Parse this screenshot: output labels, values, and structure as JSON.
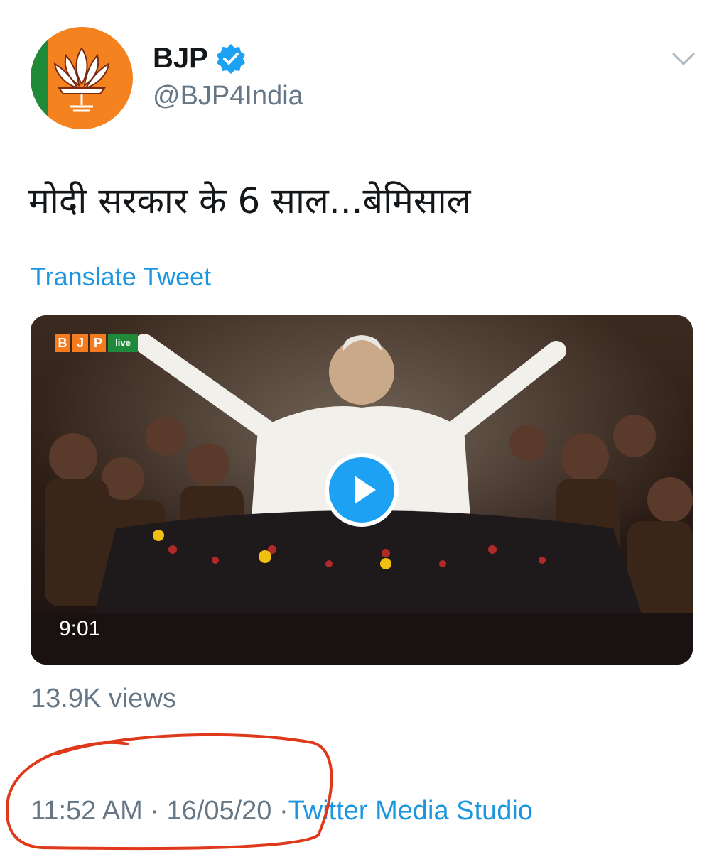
{
  "account": {
    "display_name": "BJP",
    "handle": "@BJP4India",
    "verified": true,
    "avatar_icon": "lotus-logo-icon"
  },
  "tweet": {
    "text": "मोदी सरकार के 6 साल...बेमिसाल",
    "translate_label": "Translate Tweet"
  },
  "media": {
    "type": "video",
    "duration": "9:01",
    "brand_tag": [
      "B",
      "J",
      "P",
      "live"
    ],
    "views": "13.9K views"
  },
  "meta": {
    "time": "11:52 AM",
    "separator": "·",
    "date": "16/05/20",
    "source": "Twitter Media Studio"
  },
  "colors": {
    "link": "#1b95e0",
    "secondary_text": "#657786",
    "play_button": "#1da1f2",
    "annotation": "#e0381b",
    "avatar_bg": "#f4821f"
  }
}
